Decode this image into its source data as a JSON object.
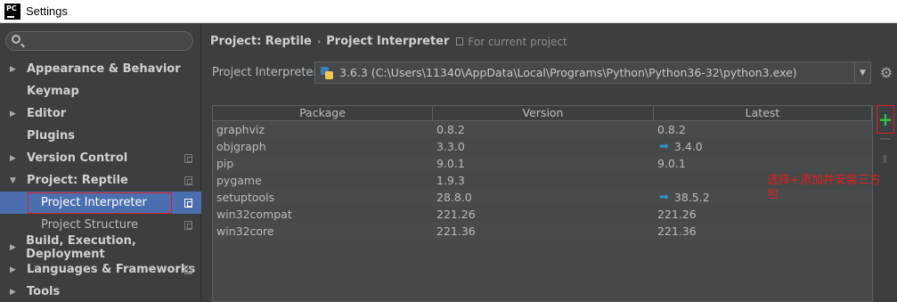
{
  "window": {
    "title": "Settings",
    "app_icon_text": "PC"
  },
  "sidebar": {
    "search_placeholder": "",
    "items": [
      {
        "label": "Appearance & Behavior",
        "expandable": true,
        "expanded": false
      },
      {
        "label": "Keymap",
        "expandable": false
      },
      {
        "label": "Editor",
        "expandable": true,
        "expanded": false
      },
      {
        "label": "Plugins",
        "expandable": false
      },
      {
        "label": "Version Control",
        "expandable": true,
        "expanded": false,
        "has_copy_icon": true
      },
      {
        "label": "Project: Reptile",
        "expandable": true,
        "expanded": true,
        "has_copy_icon": true
      },
      {
        "label": "Project Interpreter",
        "child": true,
        "selected": true,
        "has_copy_icon": true
      },
      {
        "label": "Project Structure",
        "child": true,
        "has_copy_icon": true
      },
      {
        "label": "Build, Execution, Deployment",
        "expandable": true,
        "expanded": false
      },
      {
        "label": "Languages & Frameworks",
        "expandable": true,
        "expanded": false,
        "has_copy_icon": true
      },
      {
        "label": "Tools",
        "expandable": true,
        "expanded": false
      }
    ]
  },
  "main": {
    "breadcrumb": [
      "Project: Reptile",
      "Project Interpreter"
    ],
    "breadcrumb_note": "For current project",
    "interpreter_label": "Project Interpreter:",
    "interpreter_value": "3.6.3 (C:\\Users\\11340\\AppData\\Local\\Programs\\Python\\Python36-32\\python3.exe)",
    "table": {
      "columns": [
        "Package",
        "Version",
        "Latest"
      ],
      "rows": [
        {
          "package": "graphviz",
          "version": "0.8.2",
          "latest": "0.8.2",
          "upgrade": false
        },
        {
          "package": "objgraph",
          "version": "3.3.0",
          "latest": "3.4.0",
          "upgrade": true
        },
        {
          "package": "pip",
          "version": "9.0.1",
          "latest": "9.0.1",
          "upgrade": false
        },
        {
          "package": "pygame",
          "version": "1.9.3",
          "latest": "",
          "upgrade": false
        },
        {
          "package": "setuptools",
          "version": "28.8.0",
          "latest": "38.5.2",
          "upgrade": true
        },
        {
          "package": "win32compat",
          "version": "221.26",
          "latest": "221.26",
          "upgrade": false
        },
        {
          "package": "win32core",
          "version": "221.36",
          "latest": "221.36",
          "upgrade": false
        }
      ]
    },
    "toolbar": {
      "add_symbol": "+"
    },
    "annotation": "选择+添加并安装三方包"
  },
  "colors": {
    "background": "#3c3f41",
    "selection": "#4b6eaf",
    "highlight_box": "#e0201d",
    "add_green": "#3dbd3d",
    "upgrade_arrow": "#3592c4"
  },
  "icons": [
    "search-icon",
    "chevron-right-icon",
    "chevron-down-icon",
    "copy-icon",
    "python-icon",
    "gear-icon",
    "add-icon",
    "remove-icon",
    "up-arrow-icon",
    "upgrade-arrow-icon"
  ]
}
